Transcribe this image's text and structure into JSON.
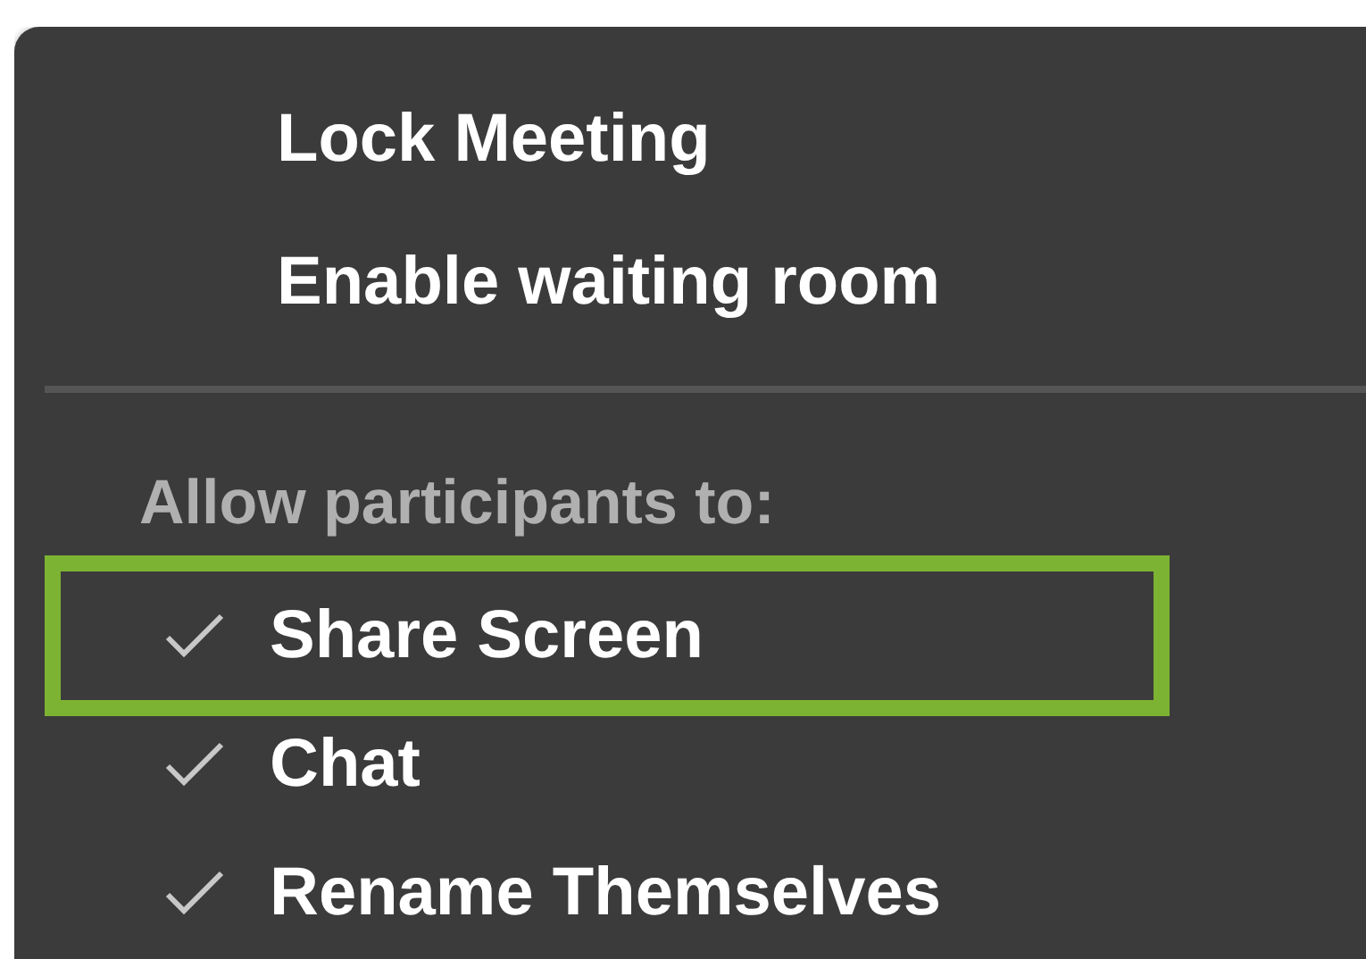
{
  "menu": {
    "actions": [
      {
        "label": "Lock Meeting"
      },
      {
        "label": "Enable waiting room"
      }
    ],
    "section": {
      "heading": "Allow participants to:",
      "options": [
        {
          "label": "Share Screen",
          "checked": true,
          "highlighted": true
        },
        {
          "label": "Chat",
          "checked": true,
          "highlighted": false
        },
        {
          "label": "Rename Themselves",
          "checked": true,
          "highlighted": false
        }
      ]
    }
  }
}
